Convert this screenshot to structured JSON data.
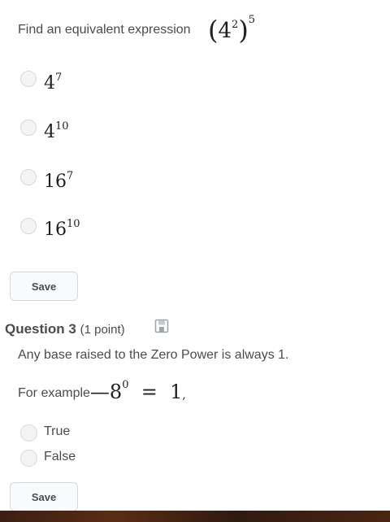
{
  "q2": {
    "prompt": "Find an equivalent expression",
    "expr_base": "4",
    "expr_inner_exp": "2",
    "expr_outer_exp": "5",
    "options": [
      {
        "base": "4",
        "exp": "7"
      },
      {
        "base": "4",
        "exp": "10"
      },
      {
        "base": "16",
        "exp": "7"
      },
      {
        "base": "16",
        "exp": "10"
      }
    ],
    "save_label": "Save"
  },
  "q3": {
    "title": "Question 3",
    "points": "(1 point)",
    "statement": "Any base raised to the Zero Power is always 1.",
    "example_prefix": "For example",
    "example_base": "8",
    "example_exp": "0",
    "example_rhs": "1",
    "options": [
      "True",
      "False"
    ],
    "save_label": "Save"
  },
  "colors": {
    "text": "#494c4e",
    "math": "#202122",
    "border": "#d3d9e3",
    "radio_fill": "#f4f4f5"
  },
  "icons": {
    "save_draft": "floppy-disk-icon"
  }
}
